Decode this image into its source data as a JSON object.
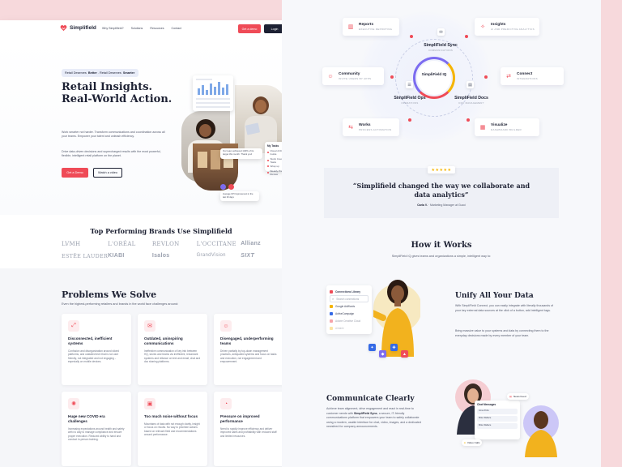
{
  "nav": {
    "logo": "Simplifield",
    "links": [
      "Why Simplifield?",
      "Solutions",
      "Resources",
      "Contact"
    ],
    "demo_btn": "Get a demo",
    "login_btn": "Login"
  },
  "hero": {
    "tag_pre": "Retail Deserves",
    "tag_b1": "Better",
    "tag_mid": ". Retail Deserves",
    "tag_b2": "Smarter",
    "title_line1": "Retail Insights.",
    "title_line2": "Real-World Action.",
    "para1": "Work smarter not harder. Transform communications and coordination across all your teams. Empower your talent and unleash efficiency.",
    "para2": "Drive data-driven decisions and supercharged results with the most powerful, flexible, intelligent retail platform on the planet.",
    "demo_btn": "Get a Demo",
    "video_btn": "Watch a video",
    "todo": {
      "title": "My Tasks",
      "items": [
        "Visual & Display Guide",
        "Stock Counting Tasks",
        "Wrap up",
        "Weekly Priority Review"
      ]
    },
    "chat_text": "Our team achieved 140% of its target this month. Thank you!",
    "stat_text": "Average KPI Improvement in the last 30 days"
  },
  "brands": {
    "title": "Top Performing Brands Use Simplifield",
    "items": [
      "LVMH",
      "L'ORÉAL",
      "REVLON",
      "L'OCCITANE",
      "Allianz",
      "ESTĒE LAUDER",
      "KIABI",
      "Isalos",
      "GrandVision",
      "SIXT"
    ]
  },
  "problems": {
    "title": "Problems We Solve",
    "subtitle": "Even the highest-performing retailers and brands in the world face challenges around:",
    "cards": [
      {
        "title": "Disconnected, inefficient systems",
        "desc": "Confusion and disorganization around siloed platforms, and outdated tech that is not user friendly, not integrated and not engaging - especially on mobile devices."
      },
      {
        "title": "Outdated, uninspiring communications",
        "desc": "Ineffective communication of key info between HQ, stores and teams via inefficient, redundant systems and reliance on text and email, chat and doc sharing platforms."
      },
      {
        "title": "Disengaged, underperforming teams",
        "desc": "Driven partially by top-down management practices, antiquated systems and focus on tasks and execution, not engagement and empowerment."
      },
      {
        "title": "Huge new COVID era challenges",
        "desc": "Increasing expectations around health and safety with no way to manage compliance and ensure proper execution. Reduced ability to hand and conduct in-person training."
      },
      {
        "title": "Too much noise without focus",
        "desc": "Mountains of data with not enough clarity, insight or focus on results. No way to prioritize actions based on relevant field and recommendations around performance."
      },
      {
        "title": "Pressure on improved performance",
        "desc": "Need to rapidly improve efficiency and deliver improved sales and profitability with reduced staff and limited resources."
      }
    ]
  },
  "ecosystem": {
    "nodes": [
      {
        "title": "Reports",
        "sub": "EXECUTIVE REPORTING"
      },
      {
        "title": "Insights",
        "sub": "AI AND PREDICTIVE ANALYTICS"
      },
      {
        "title": "Community",
        "sub": "INVITE USERS BY APPS"
      },
      {
        "title": "Connect",
        "sub": "INTEGRATIONS"
      },
      {
        "title": "Works",
        "sub": "PROCESS AUTOMATION"
      },
      {
        "title": "Visualize",
        "sub": "DASHBOARD BUILDER"
      }
    ],
    "hub": {
      "center": "SimpliField IQ",
      "top": "SimpliField Sync",
      "top_sub": "COMMUNICATIONS",
      "left": "SimpliField Ops",
      "left_sub": "OPERATIONS",
      "right": "SimpliField Docs",
      "right_sub": "DOC MANAGEMENT"
    }
  },
  "testimonial": {
    "stars": "★★★★★",
    "quote": "“Simplifield changed the way we collaborate and data analytics”",
    "author": "Carla V.",
    "role": "Marketing Manager at Gucci"
  },
  "how": {
    "title": "How it Works",
    "subtitle": "SimpliField IQ gives teams and organizations a simple, intelligent way to:"
  },
  "apps": [
    "Connections Library",
    "Search connections",
    "Google AdWords",
    "ActiveCampaign",
    "Adobe Creative Cloud",
    "Airtable"
  ],
  "unify": {
    "title": "Unify All Your Data",
    "p1": "With SimpliField Connect, you can easily integrate with literally thousands of your key external data sources at the click of a button, add intelligent tags.",
    "p2": "Bring massive value to your systems and data by connecting them to the everyday decisions made by every member of your team."
  },
  "communicate": {
    "title": "Communicate Clearly",
    "p_pre": "Achieve team alignment, drive engagement and react in real-time to customer needs with",
    "p_bold": "SimpliField Sync",
    "p_post": ", a secure, IT-friendly communications platform that empowers your team to safely collaborate using a modern, usable interface for chat, video, images, and a dedicated newsfeed for company announcements.",
    "chat_title": "Chat Messages",
    "msgs": [
      "Anna Potts",
      "Mike Wallace",
      "Mike Wallace"
    ],
    "news_chip": "News Feed",
    "video_chip": "Video Calls"
  },
  "colors": {
    "accent": "#ef4b57",
    "navy": "#1d2133",
    "ring": "#7c6cf0"
  }
}
